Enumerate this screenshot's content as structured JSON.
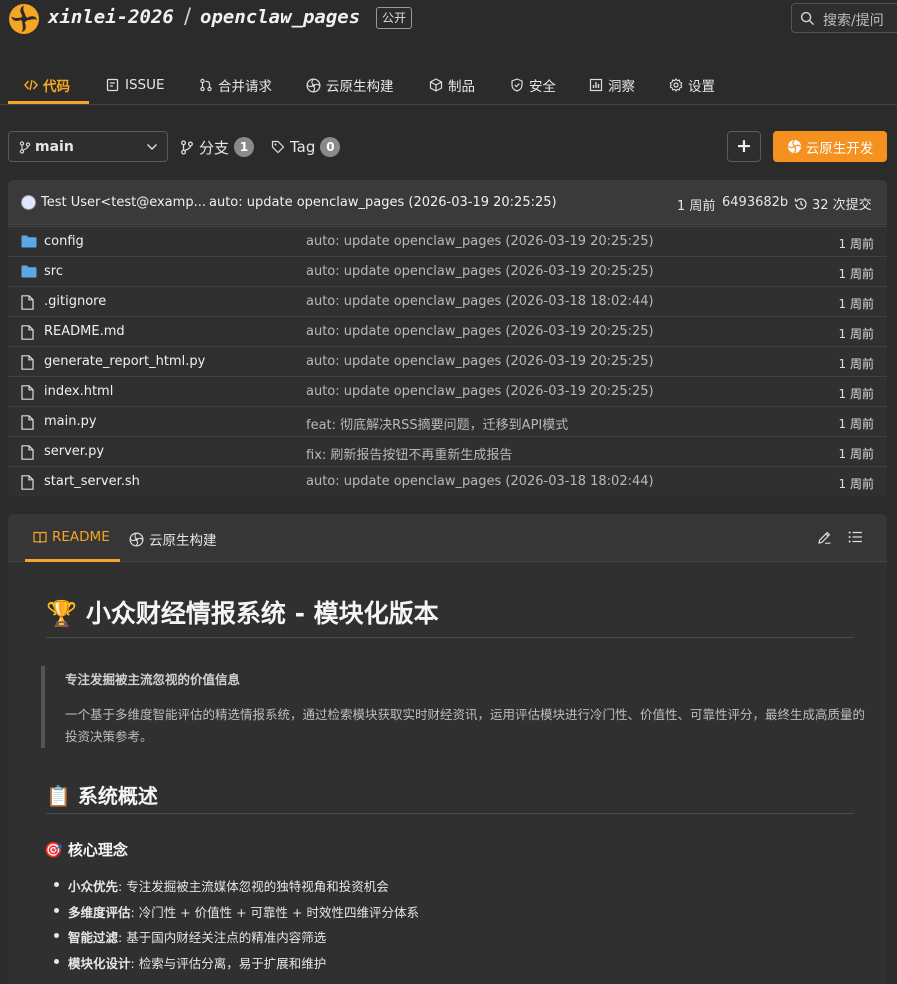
{
  "repo": {
    "owner": "xinlei-2026",
    "separator": "/",
    "name": "openclaw_pages",
    "visibility": "公开"
  },
  "search": {
    "placeholder": "搜索/提问"
  },
  "tabs": [
    {
      "label": "代码",
      "icon": "code-icon",
      "active": true
    },
    {
      "label": "ISSUE",
      "icon": "issue-icon"
    },
    {
      "label": "合并请求",
      "icon": "merge-request-icon"
    },
    {
      "label": "云原生构建",
      "icon": "cloud-build-icon"
    },
    {
      "label": "制品",
      "icon": "package-icon"
    },
    {
      "label": "安全",
      "icon": "shield-icon"
    },
    {
      "label": "洞察",
      "icon": "chart-icon"
    },
    {
      "label": "设置",
      "icon": "gear-icon"
    }
  ],
  "branch": {
    "current": "main",
    "branches_label": "分支",
    "branches_count": "1",
    "tags_label": "Tag",
    "tags_count": "0"
  },
  "actions": {
    "plus": "+",
    "dev": "云原生开发"
  },
  "accent_color": "#f5a623",
  "last_commit": {
    "author": "Test User<test@examp...",
    "message": "auto: update openclaw_pages (2026-03-19 20:25:25)",
    "time": "1 周前",
    "hash": "6493682b",
    "commits": "32 次提交"
  },
  "files": [
    {
      "type": "folder",
      "name": "config",
      "message": "auto: update openclaw_pages (2026-03-19 20:25:25)",
      "time": "1 周前"
    },
    {
      "type": "folder",
      "name": "src",
      "message": "auto: update openclaw_pages (2026-03-19 20:25:25)",
      "time": "1 周前"
    },
    {
      "type": "file",
      "name": ".gitignore",
      "message": "auto: update openclaw_pages (2026-03-18 18:02:44)",
      "time": "1 周前"
    },
    {
      "type": "file",
      "name": "README.md",
      "message": "auto: update openclaw_pages (2026-03-19 20:25:25)",
      "time": "1 周前"
    },
    {
      "type": "file",
      "name": "generate_report_html.py",
      "message": "auto: update openclaw_pages (2026-03-19 20:25:25)",
      "time": "1 周前"
    },
    {
      "type": "file",
      "name": "index.html",
      "message": "auto: update openclaw_pages (2026-03-19 20:25:25)",
      "time": "1 周前"
    },
    {
      "type": "file",
      "name": "main.py",
      "message": "feat: 彻底解决RSS摘要问题，迁移到API模式",
      "time": "1 周前"
    },
    {
      "type": "file",
      "name": "server.py",
      "message": "fix: 刷新报告按钮不再重新生成报告",
      "time": "1 周前"
    },
    {
      "type": "file",
      "name": "start_server.sh",
      "message": "auto: update openclaw_pages (2026-03-18 18:02:44)",
      "time": "1 周前"
    }
  ],
  "readme": {
    "tabs": [
      {
        "label": "README",
        "icon": "book-icon",
        "active": true
      },
      {
        "label": "云原生构建",
        "icon": "cloud-build-icon"
      }
    ],
    "h1_emoji": "🏆",
    "h1": "小众财经情报系统 - 模块化版本",
    "quote_strong": "专注发掘被主流忽视的价值信息",
    "quote_text": "一个基于多维度智能评估的精选情报系统，通过检索模块获取实时财经资讯，运用评估模块进行冷门性、价值性、可靠性评分，最终生成高质量的投资决策参考。",
    "h2_emoji": "📋",
    "h2": "系统概述",
    "h3_emoji": "🎯",
    "h3": "核心理念",
    "bullets": [
      {
        "strong": "小众优先",
        "text": ": 专注发掘被主流媒体忽视的独特视角和投资机会"
      },
      {
        "strong": "多维度评估",
        "text": ": 冷门性 + 价值性 + 可靠性 + 时效性四维评分体系"
      },
      {
        "strong": "智能过滤",
        "text": ": 基于国内财经关注点的精准内容筛选"
      },
      {
        "strong": "模块化设计",
        "text": ": 检索与评估分离，易于扩展和维护"
      }
    ]
  }
}
